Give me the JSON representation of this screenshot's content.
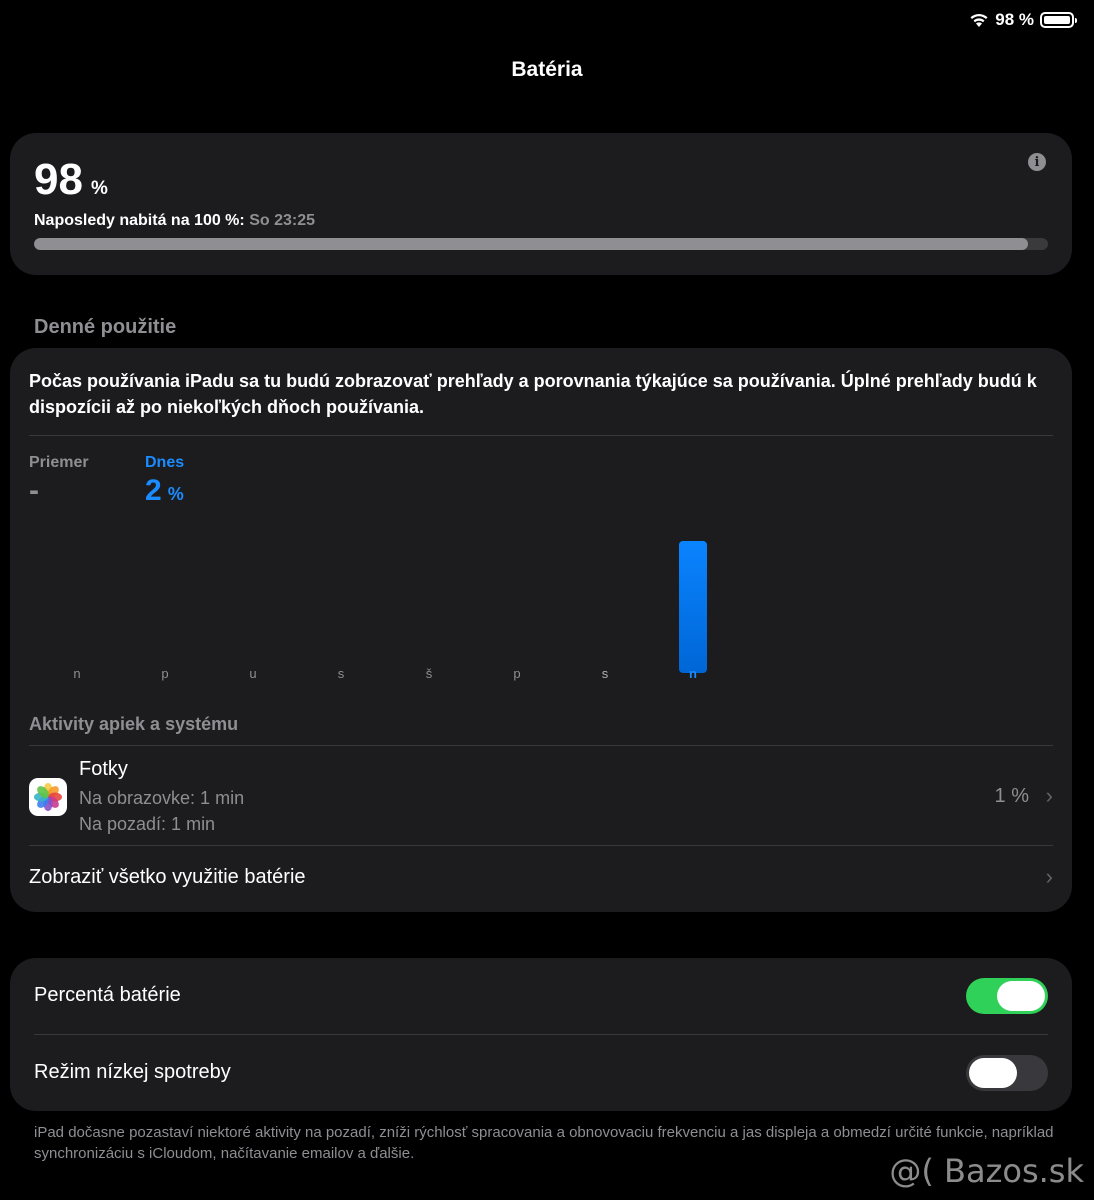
{
  "status": {
    "battery_pct": "98 %",
    "icons": [
      "wifi-icon",
      "battery-icon"
    ]
  },
  "title": "Batéria",
  "level": {
    "value": "98",
    "unit": "%",
    "last_charged_label": "Naposledy nabitá na 100 %:",
    "last_charged_value": "So 23:25",
    "fraction": 0.98
  },
  "daily_usage": {
    "section_title": "Denné použitie",
    "description": "Počas používania iPadu sa tu budú zobrazovať prehľady a porovnania týkajúce sa používania. Úplné prehľady budú k dispozícii až po niekoľkých dňoch používania.",
    "average_label": "Priemer",
    "average_value": "-",
    "today_label": "Dnes",
    "today_value": "2",
    "today_unit": "%",
    "days": [
      "n",
      "p",
      "u",
      "s",
      "š",
      "p",
      "s",
      "n"
    ],
    "values": [
      0,
      0,
      0,
      0,
      0,
      0,
      0,
      2
    ],
    "colors": {
      "accent": "#1a8cff"
    }
  },
  "activity": {
    "title": "Aktivity apiek a systému",
    "apps": [
      {
        "name": "Fotky",
        "screen": "Na obrazovke: 1 min",
        "background": "Na pozadí: 1 min",
        "pct": "1 %",
        "icon": "photos-icon"
      }
    ],
    "show_all": "Zobraziť všetko využitie batérie"
  },
  "settings": {
    "battery_pct_label": "Percentá batérie",
    "battery_pct_on": true,
    "low_power_label": "Režim nízkej spotreby",
    "low_power_on": false,
    "footer": "iPad dočasne pozastaví niektoré aktivity na pozadí, zníži rýchlosť spracovania a obnovovaciu frekvenciu a jas displeja a obmedzí určité funkcie, napríklad synchronizáciu s iCloudom, načítavanie emailov a ďalšie."
  },
  "watermark": "@( Bazos.sk"
}
